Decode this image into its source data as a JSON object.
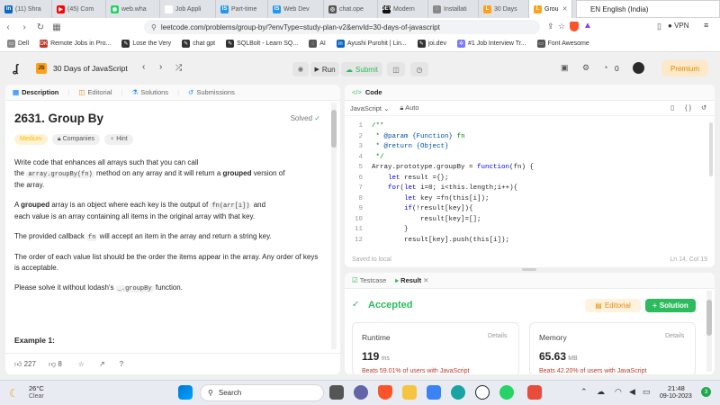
{
  "browser": {
    "tabs": [
      {
        "label": "(11) Shra",
        "color": "#0a66c2",
        "glyph": "in"
      },
      {
        "label": "(45) Com",
        "color": "#ff0000",
        "glyph": "▶"
      },
      {
        "label": "web.wha",
        "color": "#25d366",
        "glyph": "◉"
      },
      {
        "label": "Job Appli",
        "color": "#ffffff",
        "glyph": ""
      },
      {
        "label": "Part-time",
        "color": "#2196f3",
        "glyph": "IS"
      },
      {
        "label": "Web Dev",
        "color": "#2196f3",
        "glyph": "IS"
      },
      {
        "label": "chat.ope",
        "color": "#555555",
        "glyph": "◎"
      },
      {
        "label": "Modern",
        "color": "#111111",
        "glyph": "DEV"
      },
      {
        "label": "Installati",
        "color": "#888888",
        "glyph": "◌"
      },
      {
        "label": "30 Days",
        "color": "#ffa116",
        "glyph": "L"
      },
      {
        "label": "Grou",
        "color": "#ffa116",
        "glyph": "L"
      }
    ],
    "lang_indicator": "EN English (India)",
    "url": "leetcode.com/problems/group-by/?envType=study-plan-v2&envId=30-days-of-javascript",
    "vpn": "VPN",
    "bookmarks": [
      {
        "label": "Dell",
        "color": "#888888",
        "glyph": "▭"
      },
      {
        "label": "Remote Jobs in Pro...",
        "color": "#c0392b",
        "glyph": "OK"
      },
      {
        "label": "Lose the Very",
        "color": "#333333",
        "glyph": "✎"
      },
      {
        "label": "chat gpt",
        "color": "#333333",
        "glyph": "✎"
      },
      {
        "label": "SQLBolt - Learn SQ...",
        "color": "#333333",
        "glyph": "✎"
      },
      {
        "label": "AI",
        "color": "#555555",
        "glyph": "◌"
      },
      {
        "label": "Ayushi Purohit | Lin...",
        "color": "#0a66c2",
        "glyph": "in"
      },
      {
        "label": "joi.dev",
        "color": "#333333",
        "glyph": "✎"
      },
      {
        "label": "#1 Job Interview Tr...",
        "color": "#7a7aff",
        "glyph": "✲"
      },
      {
        "label": "Font Awesome",
        "color": "#555555",
        "glyph": "▭"
      }
    ]
  },
  "lc": {
    "title": "30 Days of JavaScript",
    "run": "Run",
    "submit": "Submit",
    "points": "0",
    "premium": "Premium"
  },
  "left": {
    "tabs": [
      "Description",
      "Editorial",
      "Solutions",
      "Submissions"
    ],
    "problem_title": "2631. Group By",
    "solved": "Solved",
    "tags": [
      "Medium",
      "Companies",
      "Hint"
    ],
    "p1_pre": "Write code that enhances all arrays such that you can call",
    "p1_line2_pre": "the ",
    "p1_code": "array.groupBy(fn)",
    "p1_mid": " method on any array and it will return a ",
    "p1_bold": "grouped",
    "p1_post": " version of",
    "p1_line3": "the array.",
    "p2_pre": "A ",
    "p2_bold": "grouped",
    "p2_mid": " array is an object where each key is the output of ",
    "p2_code": "fn(arr[i])",
    "p2_post": " and",
    "p2_line2": "each value is an array containing all items in the original array with that key.",
    "p3_pre": "The provided callback ",
    "p3_code": "fn",
    "p3_post": " will accept an item in the array and return a string key.",
    "p4": "The order of each value list should be the order the items appear in the array. Any order of keys is acceptable.",
    "p5_pre": "Please solve it without lodash's ",
    "p5_code": "_.groupBy",
    "p5_post": " function.",
    "example": "Example 1:",
    "likes": "227",
    "dislikes": "8"
  },
  "code": {
    "tab": "Code",
    "language": "JavaScript",
    "mode": "Auto",
    "lines": [
      {
        "n": "1",
        "t": "/**",
        "c": "cm"
      },
      {
        "n": "2",
        "t": " * @param {Function} fn",
        "c": "cm"
      },
      {
        "n": "3",
        "t": " * @return {Object}",
        "c": "cm"
      },
      {
        "n": "4",
        "t": " */",
        "c": "cm"
      },
      {
        "n": "5",
        "t": "Array.prototype.groupBy = function(fn) {",
        "c": ""
      },
      {
        "n": "6",
        "t": "    let result ={};",
        "c": ""
      },
      {
        "n": "7",
        "t": "    for(let i=0; i<this.length;i++){",
        "c": ""
      },
      {
        "n": "8",
        "t": "        let key =fn(this[i]);",
        "c": ""
      },
      {
        "n": "9",
        "t": "        if(!result[key]){",
        "c": ""
      },
      {
        "n": "10",
        "t": "            result[key]=[];",
        "c": ""
      },
      {
        "n": "11",
        "t": "        }",
        "c": ""
      },
      {
        "n": "12",
        "t": "        result[key].push(this[i]);",
        "c": ""
      }
    ],
    "saved": "Saved to local",
    "cursor": "Ln 14, Col 19"
  },
  "result": {
    "tabs": [
      "Testcase",
      "Result"
    ],
    "status": "Accepted",
    "editorial": "Editorial",
    "solution": "Solution",
    "runtime_label": "Runtime",
    "runtime_value": "119",
    "runtime_unit": "ms",
    "runtime_beats": "Beats 59.01% of users with JavaScript",
    "memory_label": "Memory",
    "memory_value": "65.63",
    "memory_unit": "MB",
    "memory_beats": "Beats 42.20% of users with JavaScript",
    "details": "Details"
  },
  "taskbar": {
    "temp": "26°C",
    "weather": "Clear",
    "search": "Search",
    "time": "21:48",
    "date": "09-10-2023",
    "badge": "3"
  }
}
